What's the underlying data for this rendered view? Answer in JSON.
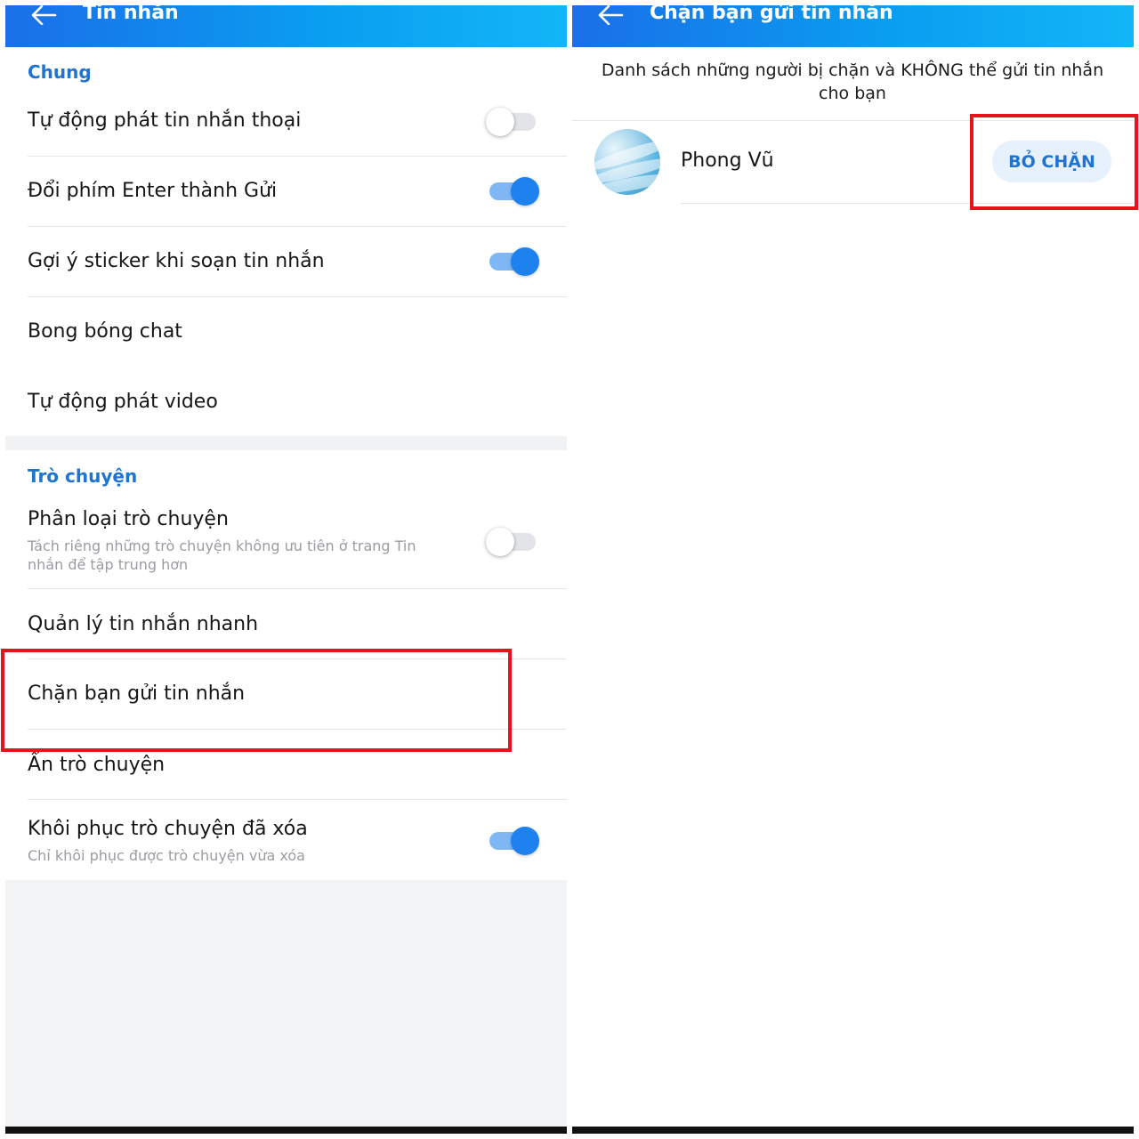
{
  "left": {
    "header": {
      "title": "Tin nhắn"
    },
    "section_general": "Chung",
    "items_general": [
      {
        "label": "Tự động phát tin nhắn thoại",
        "toggle": false
      },
      {
        "label": "Đổi phím Enter thành Gửi",
        "toggle": true
      },
      {
        "label": "Gợi ý sticker khi soạn tin nhắn",
        "toggle": true
      },
      {
        "label": "Bong bóng chat"
      },
      {
        "label": "Tự động phát video"
      }
    ],
    "section_chat": "Trò chuyện",
    "items_chat": [
      {
        "label": "Phân loại trò chuyện",
        "sub": "Tách riêng những trò chuyện không ưu tiên ở trang Tin nhắn để tập trung hơn",
        "toggle": false
      },
      {
        "label": "Quản lý tin nhắn nhanh"
      },
      {
        "label": "Chặn bạn gửi tin nhắn"
      },
      {
        "label": "Ẩn trò chuyện"
      },
      {
        "label": "Khôi phục trò chuyện đã xóa",
        "sub": "Chỉ khôi phục được trò chuyện vừa xóa",
        "toggle": true
      }
    ]
  },
  "right": {
    "header": {
      "title": "Chặn bạn gửi tin nhắn"
    },
    "info": "Danh sách những người bị chặn và KHÔNG thể gửi tin nhắn cho bạn",
    "blocked_users": [
      {
        "name": "Phong Vũ",
        "action": "BỎ CHẶN"
      }
    ]
  },
  "colors": {
    "header_start": "#1a6fe8",
    "header_end": "#12b6f7",
    "accent": "#1f74d1",
    "toggle_on": "#1d82f0",
    "highlight": "#e8121a"
  }
}
